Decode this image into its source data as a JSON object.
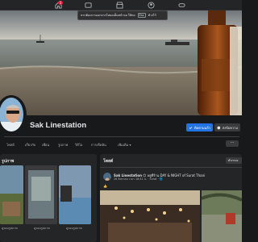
{
  "tooltip": {
    "text": "หากต้องการออกจากโหมดเต็มหน้าจอ ให้กด",
    "key": "Esc",
    "suffix": "ค้างไว้"
  },
  "topbar": {
    "notification_count": "1"
  },
  "profile": {
    "name": "Sak Linestation"
  },
  "actions": {
    "follow_label": "ติดตามแล้ว",
    "message_label": "ส่งข้อความ"
  },
  "tabs": [
    {
      "label": "โพสต์"
    },
    {
      "label": "เกี่ยวกับ"
    },
    {
      "label": "เพื่อน"
    },
    {
      "label": "รูปภาพ"
    },
    {
      "label": "วิดีโอ"
    },
    {
      "label": "การเช็คอิน"
    },
    {
      "label": "เพิ่มเติม ▾"
    }
  ],
  "tab_more": "···",
  "photos_card": {
    "header": "รูปภาพ",
    "labels": [
      "ดูรอบรูปภาพ",
      "ดูรอบรูปภาพ",
      "ดูรอบรูปภาพ"
    ]
  },
  "posts": {
    "header": "โพสต์",
    "filter_label": "ตัวกรอง",
    "author": "Sak Linestation",
    "author_suffix": "😊 อยู่ที่ร้าน DAY & NIGHT of Surat Thani",
    "meta": "26 สิงหาคม เวลา 16:41 น. · Surat · 🌐",
    "text": "👍"
  },
  "colors": {
    "accent": "#2374e1",
    "bg": "#18191a",
    "card": "#242526"
  }
}
